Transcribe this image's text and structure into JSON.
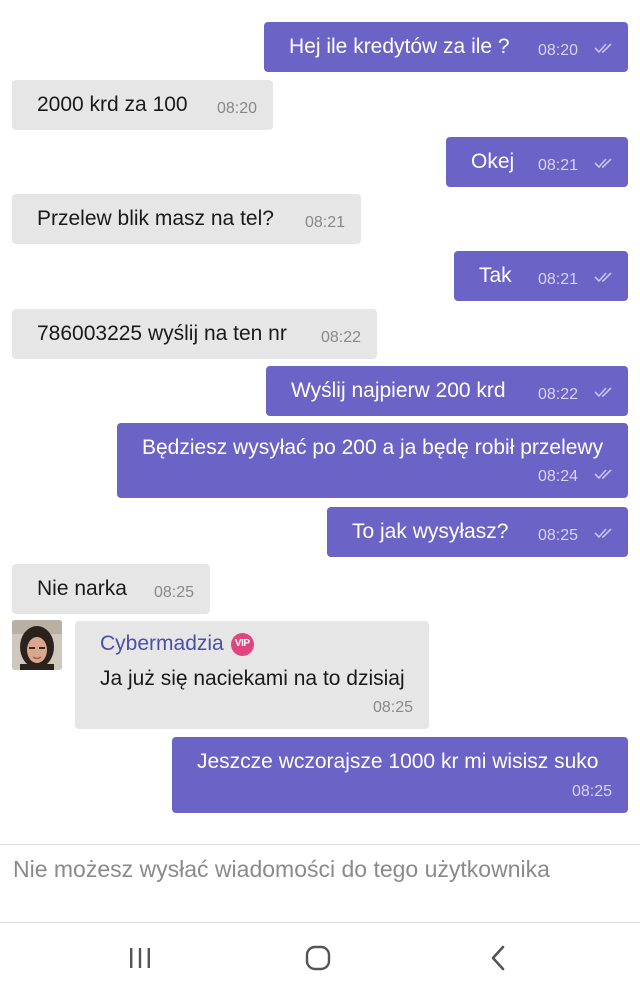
{
  "messages": [
    {
      "dir": "out",
      "text": "Hej ile kredytów za ile ?",
      "time": "08:20",
      "read": true
    },
    {
      "dir": "in",
      "text": "2000 krd za 100",
      "time": "08:20"
    },
    {
      "dir": "out",
      "text": "Okej",
      "time": "08:21",
      "read": true
    },
    {
      "dir": "in",
      "text": "Przelew blik masz na tel?",
      "time": "08:21"
    },
    {
      "dir": "out",
      "text": "Tak",
      "time": "08:21",
      "read": true
    },
    {
      "dir": "in",
      "text": "786003225 wyślij na ten nr",
      "time": "08:22"
    },
    {
      "dir": "out",
      "text": "Wyślij najpierw 200 krd",
      "time": "08:22",
      "read": true
    },
    {
      "dir": "out",
      "text": "Będziesz wysyłać po 200 a ja będę robił przelewy",
      "time": "08:24",
      "read": true
    },
    {
      "dir": "out",
      "text": "To jak wysyłasz?",
      "time": "08:25",
      "read": true
    },
    {
      "dir": "in",
      "text": "Nie narka",
      "time": "08:25"
    },
    {
      "dir": "in",
      "sender": "Cybermadzia",
      "badge": "VIP",
      "text": "Ja już się naciekami na to dzisiaj",
      "time": "08:25"
    },
    {
      "dir": "out",
      "text": "Jeszcze wczorajsze 1000 kr mi wisisz suko",
      "time": "08:25"
    }
  ],
  "composer": {
    "disabled_notice": "Nie możesz wysłać wiadomości do tego użytkownika"
  },
  "colors": {
    "outgoing_bubble": "#6b63c6",
    "incoming_bubble": "#e6e6e6",
    "sender_name": "#4b4fa8",
    "vip_badge": "#e0457d"
  },
  "navbar": {
    "icons": [
      "recent-apps-icon",
      "home-icon",
      "back-icon"
    ]
  }
}
